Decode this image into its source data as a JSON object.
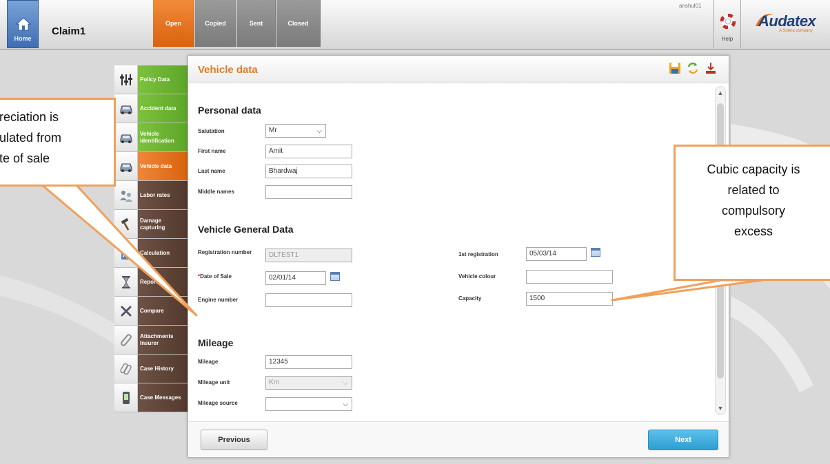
{
  "header": {
    "home_label": "Home",
    "claim_title": "Claim1",
    "status_tabs": [
      "Open",
      "Copied",
      "Sent",
      "Closed"
    ],
    "user": "anshul01",
    "help_label": "Help",
    "logo": "Audatex",
    "logo_sub": "A Solera company"
  },
  "nav": {
    "items": [
      {
        "label": "Policy Data",
        "color": "green",
        "icon": "sliders-icon"
      },
      {
        "label": "Accident data",
        "color": "green",
        "icon": "car-icon"
      },
      {
        "label": "Vehicle identification",
        "color": "green",
        "icon": "car-icon"
      },
      {
        "label": "Vehicle data",
        "color": "orange",
        "icon": "car-icon"
      },
      {
        "label": "Labor rates",
        "color": "brown",
        "icon": "people-icon"
      },
      {
        "label": "Damage capturing",
        "color": "brown",
        "icon": "hammer-icon"
      },
      {
        "label": "Calculation",
        "color": "brown",
        "icon": "calculator-icon"
      },
      {
        "label": "Reports",
        "color": "brown",
        "icon": "hourglass-icon"
      },
      {
        "label": "Compare",
        "color": "brown",
        "icon": "tools-icon"
      },
      {
        "label": "Attachments Insurer",
        "color": "brown",
        "icon": "paperclip-icon"
      },
      {
        "label": "Case History",
        "color": "brown",
        "icon": "clips-icon"
      },
      {
        "label": "Case Messages",
        "color": "brown",
        "icon": "phone-icon"
      }
    ]
  },
  "panel": {
    "title": "Vehicle data",
    "personal": {
      "title": "Personal data",
      "salutation_label": "Salutation",
      "salutation_value": "Mr",
      "first_name_label": "First name",
      "first_name_value": "Amit",
      "last_name_label": "Last name",
      "last_name_value": "Bhardwaj",
      "middle_names_label": "Middle names",
      "middle_names_value": ""
    },
    "vehicle": {
      "title": "Vehicle General Data",
      "registration_label": "Registration number",
      "registration_value": "DLTEST1",
      "date_of_sale_label": "Date of Sale",
      "date_of_sale_value": "02/01/14",
      "engine_label": "Engine number",
      "engine_value": "",
      "first_reg_label": "1st registration",
      "first_reg_value": "05/03/14",
      "colour_label": "Vehicle colour",
      "colour_value": "",
      "capacity_label": "Capacity",
      "capacity_value": "1500"
    },
    "mileage": {
      "title": "Mileage",
      "mileage_label": "Mileage",
      "mileage_value": "12345",
      "unit_label": "Mileage unit",
      "unit_value": "Km",
      "source_label": "Mileage source",
      "source_value": ""
    },
    "prev_label": "Previous",
    "next_label": "Next"
  },
  "callouts": {
    "left_lines": [
      "reciation is",
      "ulated from",
      "te of sale"
    ],
    "right_lines": [
      "Cubic capacity is",
      "related to",
      "compulsory",
      "excess"
    ]
  },
  "colors": {
    "accent_orange": "#e07a2a",
    "nav_green": "#5ea628",
    "nav_brown": "#54392d",
    "next_blue": "#2f9ed2",
    "callout_border": "#f0a05a"
  }
}
